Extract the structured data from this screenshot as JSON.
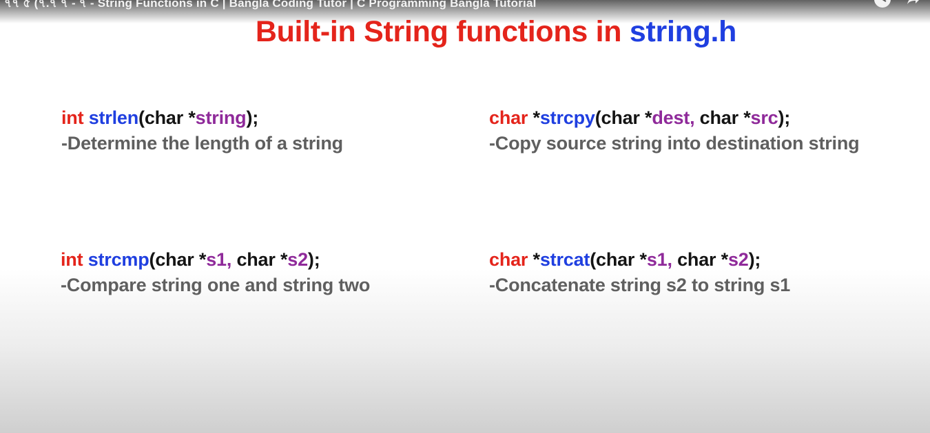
{
  "video": {
    "title": "৭৭ ৫ (৭.৭ ৭ - ৭ - String Functions in C | Bangla Coding Tutor | C Programming Bangla Tutorial"
  },
  "slide": {
    "heading_part1": "Built-in String functions in ",
    "heading_part2": "string.h",
    "functions": [
      {
        "return_type": "int",
        "pointer": "",
        "name": "strlen",
        "open_paren": "(",
        "param1_type": "char *",
        "param1_name": "string",
        "separator": "",
        "param2_type": "",
        "param2_name": "",
        "close": ");",
        "description": "-Determine the length of a string"
      },
      {
        "return_type": "char",
        "pointer": "*",
        "name": "strcpy",
        "open_paren": "(",
        "param1_type": "char *",
        "param1_name": "dest",
        "separator": ", ",
        "param2_type": "char *",
        "param2_name": "src",
        "close": ");",
        "description": "-Copy source string into destination string"
      },
      {
        "return_type": "int",
        "pointer": "",
        "name": "strcmp",
        "open_paren": "(",
        "param1_type": "char *",
        "param1_name": "s1",
        "separator": ", ",
        "param2_type": "char *",
        "param2_name": "s2",
        "close": ");",
        "description": "-Compare string one and string two"
      },
      {
        "return_type": "char",
        "pointer": "*",
        "name": "strcat",
        "open_paren": "(",
        "param1_type": "char *",
        "param1_name": "s1",
        "separator": ", ",
        "param2_type": "char *",
        "param2_name": "s2",
        "close": ");",
        "description": "-Concatenate string s2 to string s1"
      }
    ]
  },
  "colors": {
    "keyword_red": "#e4241b",
    "function_blue": "#1f3fe0",
    "param_purple": "#8f2a9a",
    "description_gray": "#5f5f5f"
  },
  "icons": {
    "top_right": [
      "clock-icon",
      "share-icon"
    ]
  }
}
